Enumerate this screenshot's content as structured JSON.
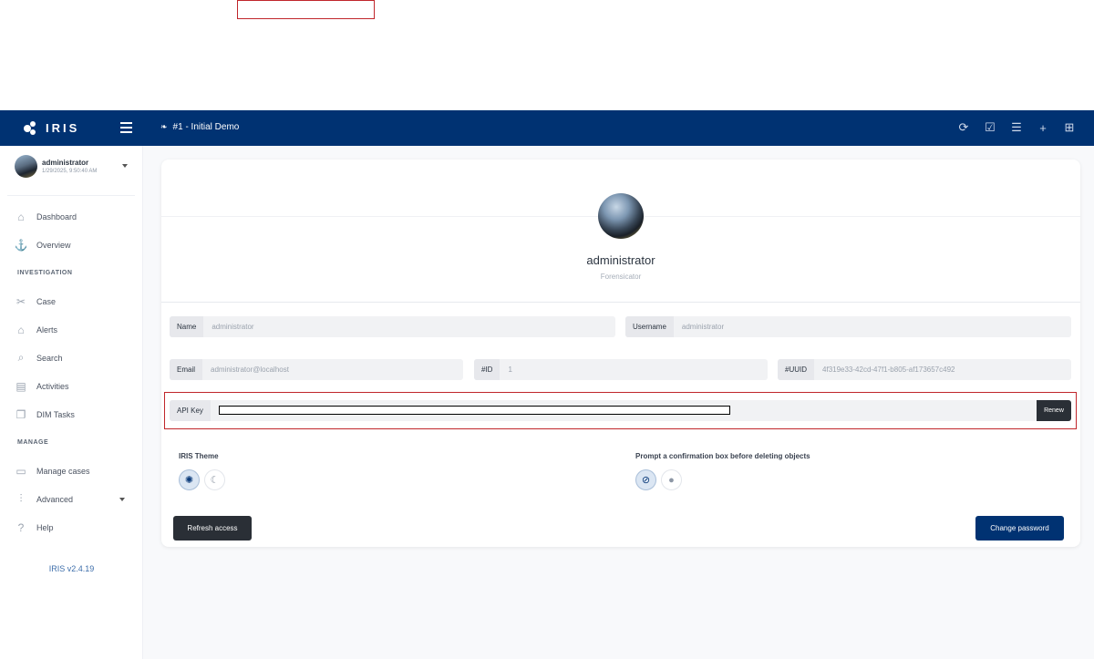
{
  "app": {
    "brand": "IRIS",
    "case_title": "#1 - Initial Demo"
  },
  "user": {
    "name": "administrator",
    "last_login": "1/29/2025, 9:50:40 AM"
  },
  "sidebar": {
    "items": [
      {
        "label": "Dashboard",
        "icon": "home-icon"
      },
      {
        "label": "Overview",
        "icon": "overview-icon"
      }
    ],
    "sections": [
      {
        "title": "INVESTIGATION",
        "items": [
          {
            "label": "Case",
            "icon": "case-icon"
          },
          {
            "label": "Alerts",
            "icon": "bell-icon"
          },
          {
            "label": "Search",
            "icon": "search-icon"
          },
          {
            "label": "Activities",
            "icon": "file-icon"
          },
          {
            "label": "DIM Tasks",
            "icon": "tasks-icon"
          }
        ]
      },
      {
        "title": "MANAGE",
        "items": [
          {
            "label": "Manage cases",
            "icon": "folder-icon"
          },
          {
            "label": "Advanced",
            "icon": "sliders-icon"
          },
          {
            "label": "Help",
            "icon": "help-icon"
          }
        ]
      }
    ],
    "version": "IRIS v2.4.19"
  },
  "profile": {
    "name": "administrator",
    "role": "Forensicator",
    "fields": {
      "name": {
        "label": "Name",
        "value": "administrator"
      },
      "username": {
        "label": "Username",
        "value": "administrator"
      },
      "email": {
        "label": "Email",
        "value": "administrator@localhost"
      },
      "id": {
        "label": "#ID",
        "value": "1"
      },
      "uuid": {
        "label": "#UUID",
        "value": "4f319e33-42cd-47f1-b805-af173657c492"
      },
      "api_key": {
        "label": "API Key",
        "value": ""
      }
    },
    "renew_label": "Renew",
    "theme_title": "IRIS Theme",
    "confirm_title": "Prompt a confirmation box before deleting objects",
    "refresh_label": "Refresh access",
    "change_password_label": "Change password"
  },
  "colors": {
    "navbar": "#003272",
    "accent": "#003272",
    "dark_button": "#2a2f36",
    "highlight_border": "#c0262b"
  }
}
